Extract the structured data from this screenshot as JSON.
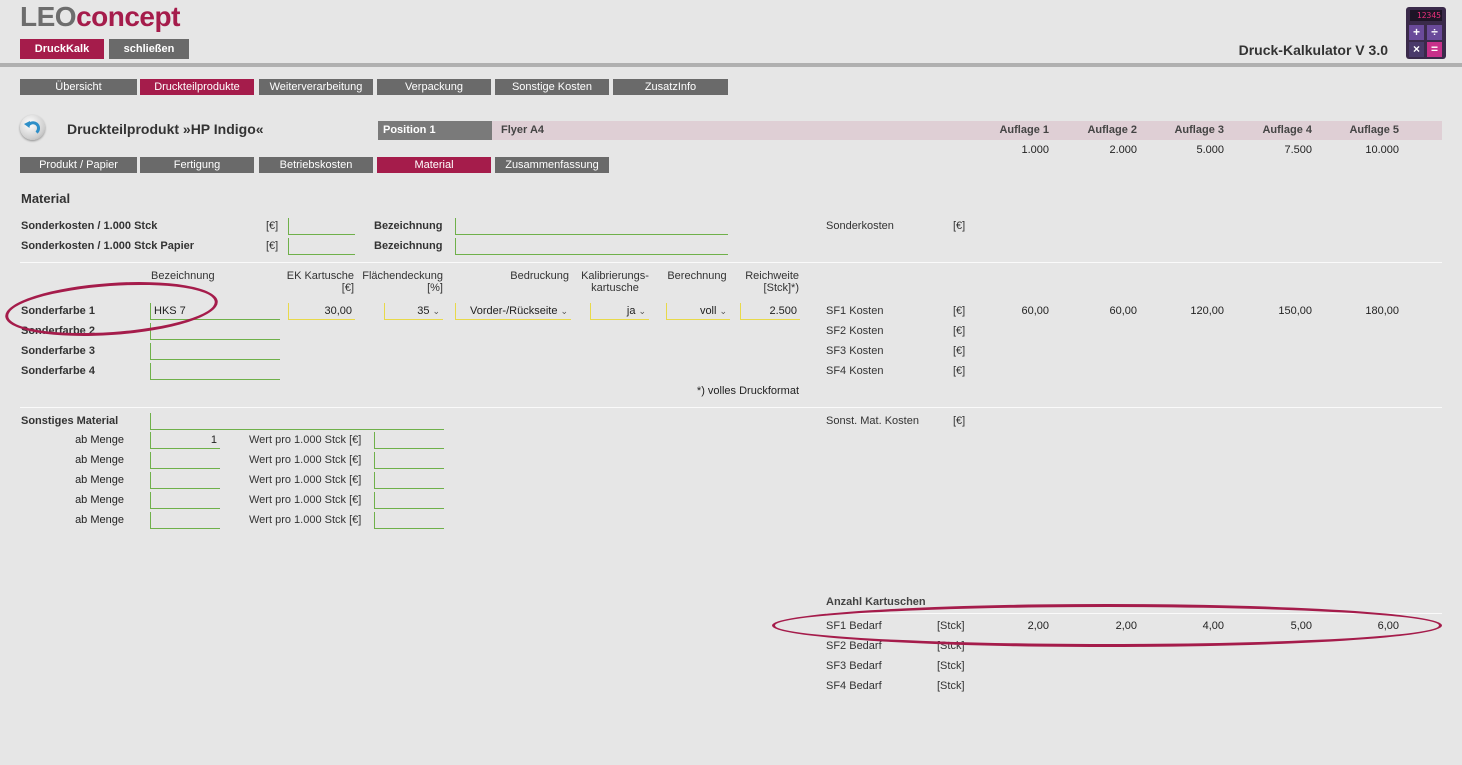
{
  "logo": {
    "part1": "LEO",
    "part2": "concept"
  },
  "header": {
    "app_button": "DruckKalk",
    "close_button": "schließen",
    "app_title": "Druck-Kalkulator V 3.0",
    "calc_display": "12345"
  },
  "main_tabs": [
    "Übersicht",
    "Druckteilprodukte",
    "Weiterverarbeitung",
    "Verpackung",
    "Sonstige Kosten",
    "ZusatzInfo"
  ],
  "product": {
    "title": "Druckteilprodukt »HP Indigo«",
    "position_label": "Position 1",
    "position_name": "Flyer A4"
  },
  "auflagen": {
    "labels": [
      "Auflage 1",
      "Auflage 2",
      "Auflage 3",
      "Auflage 4",
      "Auflage 5"
    ],
    "values": [
      "1.000",
      "2.000",
      "5.000",
      "7.500",
      "10.000"
    ]
  },
  "sub_tabs": [
    "Produkt / Papier",
    "Fertigung",
    "Betriebskosten",
    "Material",
    "Zusammenfassung"
  ],
  "material": {
    "section_title": "Material",
    "sonderkosten_rows": [
      {
        "label": "Sonderkosten / 1.000 Stck",
        "unit": "[€]",
        "bez_label": "Bezeichnung"
      },
      {
        "label": "Sonderkosten / 1.000 Stck Papier",
        "unit": "[€]",
        "bez_label": "Bezeichnung"
      }
    ],
    "sonderkosten_result": {
      "label": "Sonderkosten",
      "unit": "[€]"
    },
    "headers": {
      "bezeichnung": "Bezeichnung",
      "ek_kartusche_1": "EK Kartusche",
      "ek_kartusche_2": "[€]",
      "flaechendeckung_1": "Flächendeckung",
      "flaechendeckung_2": "[%]",
      "bedruckung": "Bedruckung",
      "kalibrierung_1": "Kalibrierungs-",
      "kalibrierung_2": "kartusche",
      "berechnung": "Berechnung",
      "reichweite_1": "Reichweite",
      "reichweite_2": "[Stck]*)"
    },
    "sonderfarben": [
      {
        "label": "Sonderfarbe 1",
        "name": "HKS 7",
        "ek": "30,00",
        "deckung": "35",
        "bedruckung": "Vorder-/Rückseite",
        "kalibrierung": "ja",
        "berechnung": "voll",
        "reichweite": "2.500",
        "cost_label": "SF1 Kosten",
        "unit": "[€]",
        "costs": [
          "60,00",
          "60,00",
          "120,00",
          "150,00",
          "180,00"
        ]
      },
      {
        "label": "Sonderfarbe 2",
        "name": "",
        "cost_label": "SF2 Kosten",
        "unit": "[€]"
      },
      {
        "label": "Sonderfarbe 3",
        "name": "",
        "cost_label": "SF3 Kosten",
        "unit": "[€]"
      },
      {
        "label": "Sonderfarbe 4",
        "name": "",
        "cost_label": "SF4 Kosten",
        "unit": "[€]"
      }
    ],
    "footnote": "*) volles Druckformat",
    "sonstiges": {
      "label": "Sonstiges Material",
      "ab_menge_label": "ab Menge",
      "wert_label": "Wert pro 1.000 Stck [€]",
      "first_menge": "1",
      "result_label": "Sonst. Mat. Kosten",
      "result_unit": "[€]"
    },
    "kartuschen": {
      "title": "Anzahl Kartuschen",
      "rows": [
        {
          "label": "SF1 Bedarf",
          "unit": "[Stck]",
          "values": [
            "2,00",
            "2,00",
            "4,00",
            "5,00",
            "6,00"
          ]
        },
        {
          "label": "SF2 Bedarf",
          "unit": "[Stck]"
        },
        {
          "label": "SF3 Bedarf",
          "unit": "[Stck]"
        },
        {
          "label": "SF4 Bedarf",
          "unit": "[Stck]"
        }
      ]
    }
  }
}
